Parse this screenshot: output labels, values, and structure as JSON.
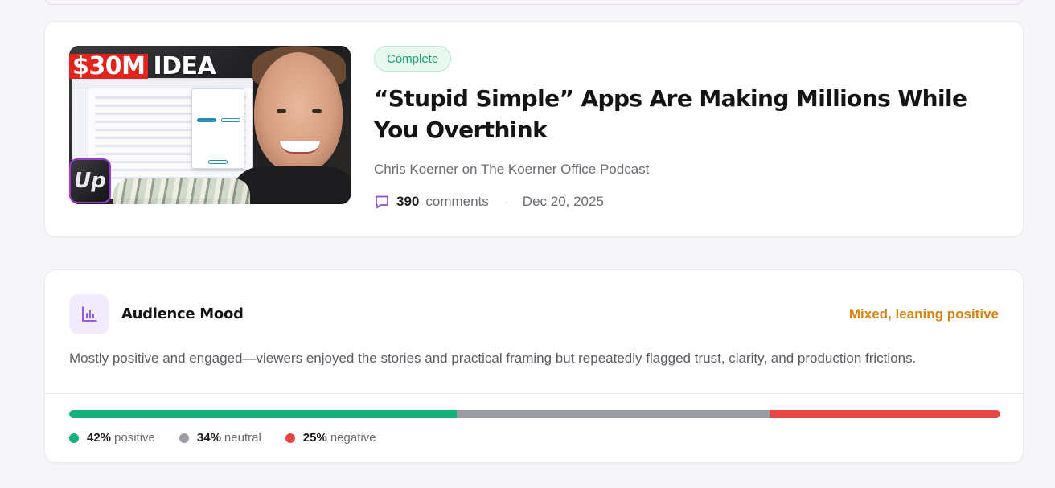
{
  "video": {
    "thumbnail": {
      "headline_red": "$30M",
      "headline_white": "IDEA",
      "logo_text": "Up"
    },
    "status": "Complete",
    "title": "“Stupid Simple” Apps Are Making Millions While You Overthink",
    "channel_line": "Chris Koerner on The Koerner Office Podcast",
    "comment_count": "390",
    "comments_label": "comments",
    "separator": "·",
    "date": "Dec 20, 2025",
    "icons": {
      "comments": "comment-bubble-icon"
    }
  },
  "mood": {
    "icon": "bar-chart-icon",
    "title": "Audience Mood",
    "verdict": "Mixed, leaning positive",
    "summary": "Mostly positive and engaged—viewers enjoyed the stories and practical framing but repeatedly flagged trust, clarity, and production frictions.",
    "sentiment": [
      {
        "key": "positive",
        "percent": 42,
        "pct_label": "42%",
        "label": "positive",
        "color": "#16b27a"
      },
      {
        "key": "neutral",
        "percent": 34,
        "pct_label": "34%",
        "label": "neutral",
        "color": "#9b9ca4"
      },
      {
        "key": "negative",
        "percent": 25,
        "pct_label": "25%",
        "label": "negative",
        "color": "#e54747"
      }
    ]
  },
  "colors": {
    "accent_purple": "#8b4fd6",
    "complete_green": "#15a56a",
    "verdict_orange": "#d88412"
  }
}
